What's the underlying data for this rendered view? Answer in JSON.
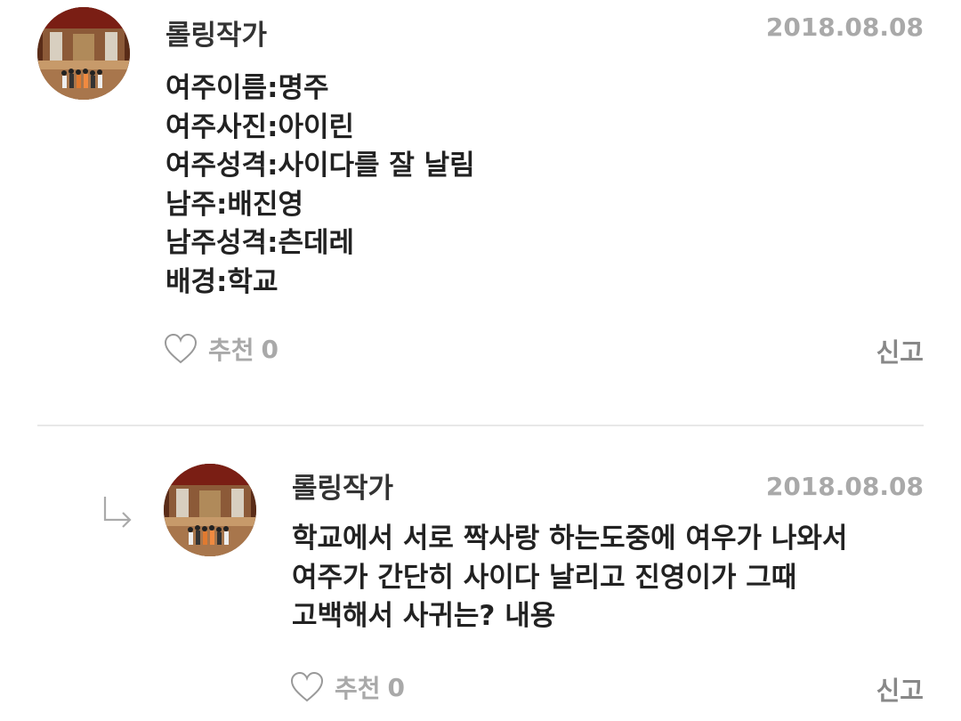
{
  "comments": [
    {
      "author": "롤링작가",
      "date": "2018.08.08",
      "lines": [
        "여주이름:명주",
        "여주사진:아이린",
        "여주성격:사이다를 잘 날림",
        "남주:배진영",
        "남주성격:츤데레",
        "배경:학교"
      ],
      "like_label": "추천",
      "like_count": "0",
      "report_label": "신고"
    },
    {
      "author": "롤링작가",
      "date": "2018.08.08",
      "lines": [
        "학교에서 서로 짝사랑 하는도중에 여우가 나와서",
        "여주가 간단히 사이다 날리고 진영이가 그때",
        "고백해서 사귀는?  내용"
      ],
      "like_label": "추천",
      "like_count": "0",
      "report_label": "신고",
      "is_reply": true
    }
  ],
  "icons": {
    "heart": "heart-outline-icon",
    "reply": "reply-arrow-icon",
    "avatar": "group-photo-avatar"
  },
  "colors": {
    "text": "#222222",
    "muted": "#a9a9a9",
    "divider": "#e8e8e8"
  }
}
